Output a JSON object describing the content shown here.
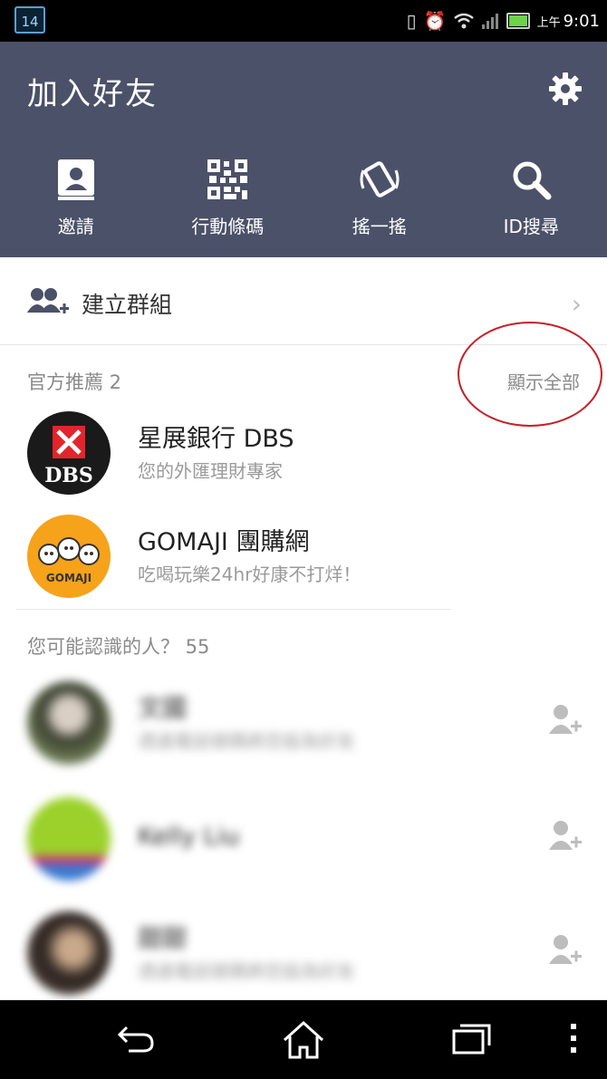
{
  "status_bar": {
    "calendar_day": "14",
    "time_prefix": "上午",
    "time": "9:01",
    "icons": [
      "vibrate-icon",
      "alarm-icon",
      "wifi-icon",
      "signal-icon",
      "battery-icon"
    ]
  },
  "header": {
    "title": "加入好友",
    "settings_icon": "gear-icon",
    "actions": [
      {
        "label": "邀請",
        "icon": "contact-book-icon"
      },
      {
        "label": "行動條碼",
        "icon": "qr-code-icon"
      },
      {
        "label": "搖一搖",
        "icon": "shake-phone-icon"
      },
      {
        "label": "ID搜尋",
        "icon": "search-icon"
      }
    ]
  },
  "create_group": {
    "label": "建立群組",
    "icon": "group-add-icon"
  },
  "official": {
    "heading": "官方推薦 2",
    "show_all": "顯示全部",
    "items": [
      {
        "name": "星展銀行 DBS",
        "subtitle": "您的外匯理財專家"
      },
      {
        "name": "GOMAJI 團購網",
        "subtitle": "吃喝玩樂24hr好康不打烊！"
      }
    ]
  },
  "suggested": {
    "heading": "您可能認識的人？ 55",
    "items": [
      {
        "name": "文國",
        "subtitle": "透過電話號碼將您設為好友"
      },
      {
        "name": "Kelly Liu",
        "subtitle": ""
      },
      {
        "name": "甜甜",
        "subtitle": "透過電話號碼將您設為好友"
      }
    ]
  },
  "nav": {
    "icons": [
      "back-icon",
      "home-icon",
      "recent-apps-icon",
      "menu-icon"
    ]
  },
  "colors": {
    "header_bg": "#4b5168",
    "annotation": "#c6202a"
  }
}
